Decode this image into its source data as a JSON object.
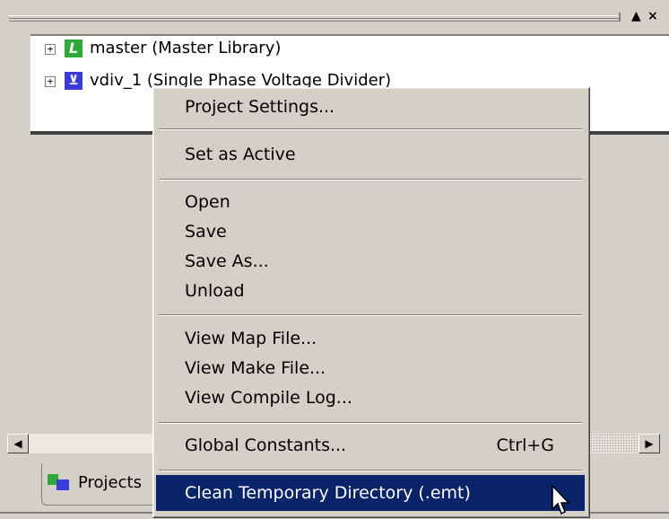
{
  "tree": {
    "items": [
      {
        "label": "master (Master Library)",
        "icon": "library-icon",
        "expander": "+"
      },
      {
        "label": "vdiv_1 (Single Phase Voltage Divider)",
        "icon": "project-icon",
        "expander": "+"
      }
    ]
  },
  "titlebar": {
    "pin": "▲",
    "close": "×"
  },
  "scrollbar": {
    "left": "◀",
    "right": "▶"
  },
  "tabs": [
    {
      "label": "Projects"
    }
  ],
  "menu": {
    "items": [
      {
        "label": "Project Settings..."
      },
      {
        "label": "Set as Active"
      },
      {
        "label": "Open"
      },
      {
        "label": "Save"
      },
      {
        "label": "Save As..."
      },
      {
        "label": "Unload"
      },
      {
        "label": "View Map File..."
      },
      {
        "label": "View Make File..."
      },
      {
        "label": "View Compile Log..."
      },
      {
        "label": "Global Constants...",
        "shortcut": "Ctrl+G"
      },
      {
        "label": "Clean Temporary Directory (.emt)"
      }
    ]
  },
  "colors": {
    "highlight": "#0a246a",
    "library_icon": "#2fa83a",
    "project_icon": "#3b3bdc"
  }
}
